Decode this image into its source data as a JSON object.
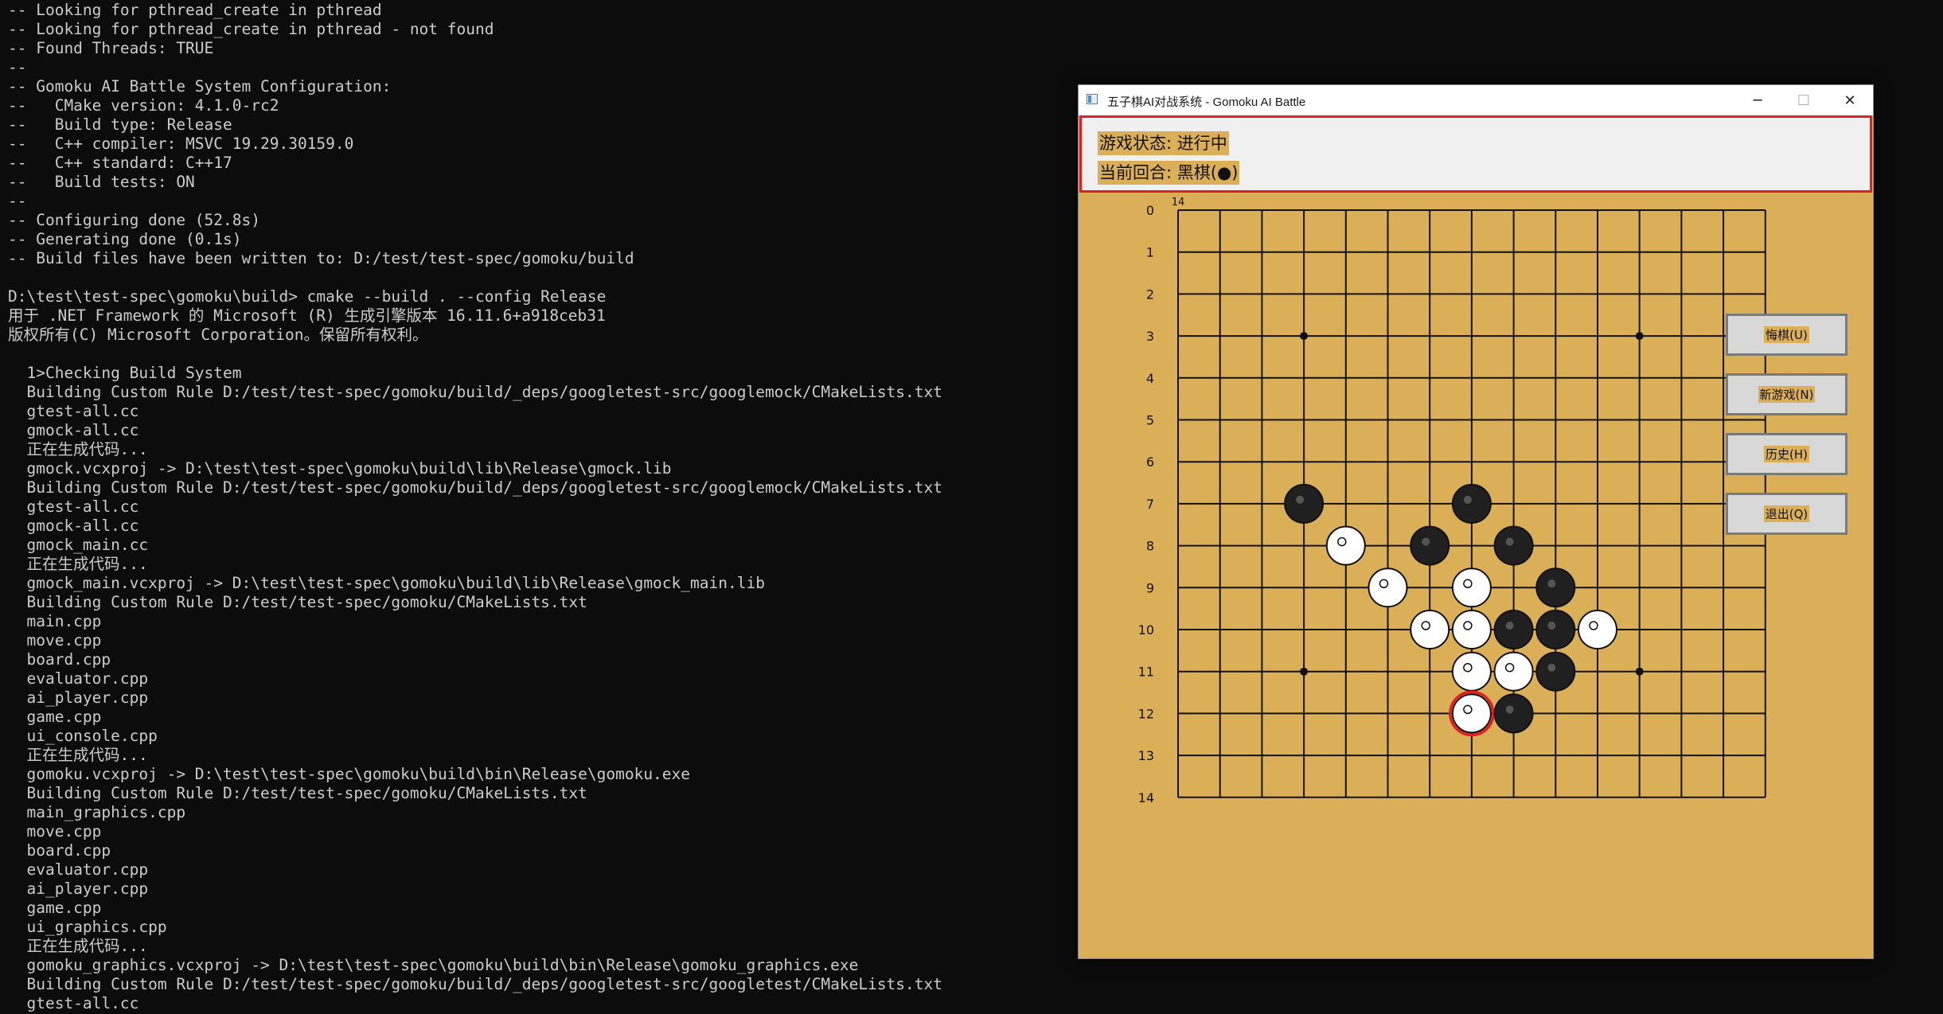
{
  "terminal": {
    "lines": [
      "-- Looking for pthread_create in pthread",
      "-- Looking for pthread_create in pthread - not found",
      "-- Found Threads: TRUE",
      "--",
      "-- Gomoku AI Battle System Configuration:",
      "--   CMake version: 4.1.0-rc2",
      "--   Build type: Release",
      "--   C++ compiler: MSVC 19.29.30159.0",
      "--   C++ standard: C++17",
      "--   Build tests: ON",
      "--",
      "-- Configuring done (52.8s)",
      "-- Generating done (0.1s)",
      "-- Build files have been written to: D:/test/test-spec/gomoku/build",
      "",
      "D:\\test\\test-spec\\gomoku\\build> cmake --build . --config Release",
      "用于 .NET Framework 的 Microsoft (R) 生成引擎版本 16.11.6+a918ceb31",
      "版权所有(C) Microsoft Corporation。保留所有权利。",
      "",
      "  1>Checking Build System",
      "  Building Custom Rule D:/test/test-spec/gomoku/build/_deps/googletest-src/googlemock/CMakeLists.txt",
      "  gtest-all.cc",
      "  gmock-all.cc",
      "  正在生成代码...",
      "  gmock.vcxproj -> D:\\test\\test-spec\\gomoku\\build\\lib\\Release\\gmock.lib",
      "  Building Custom Rule D:/test/test-spec/gomoku/build/_deps/googletest-src/googlemock/CMakeLists.txt",
      "  gtest-all.cc",
      "  gmock-all.cc",
      "  gmock_main.cc",
      "  正在生成代码...",
      "  gmock_main.vcxproj -> D:\\test\\test-spec\\gomoku\\build\\lib\\Release\\gmock_main.lib",
      "  Building Custom Rule D:/test/test-spec/gomoku/CMakeLists.txt",
      "  main.cpp",
      "  move.cpp",
      "  board.cpp",
      "  evaluator.cpp",
      "  ai_player.cpp",
      "  game.cpp",
      "  ui_console.cpp",
      "  正在生成代码...",
      "  gomoku.vcxproj -> D:\\test\\test-spec\\gomoku\\build\\bin\\Release\\gomoku.exe",
      "  Building Custom Rule D:/test/test-spec/gomoku/CMakeLists.txt",
      "  main_graphics.cpp",
      "  move.cpp",
      "  board.cpp",
      "  evaluator.cpp",
      "  ai_player.cpp",
      "  game.cpp",
      "  ui_graphics.cpp",
      "  正在生成代码...",
      "  gomoku_graphics.vcxproj -> D:\\test\\test-spec\\gomoku\\build\\bin\\Release\\gomoku_graphics.exe",
      "  Building Custom Rule D:/test/test-spec/gomoku/build/_deps/googletest-src/googletest/CMakeLists.txt",
      "  gtest-all.cc"
    ]
  },
  "window": {
    "title": "五子棋AI对战系统 - Gomoku AI Battle",
    "minimize_glyph": "─",
    "maximize_glyph": "☐",
    "close_glyph": "✕"
  },
  "status": {
    "game_state": "游戏状态: 进行中",
    "turn": "当前回合: 黑棋(●)"
  },
  "board": {
    "size": 15,
    "top_label": "14",
    "row_labels": [
      "0",
      "1",
      "2",
      "3",
      "4",
      "5",
      "6",
      "7",
      "8",
      "9",
      "10",
      "11",
      "12",
      "13",
      "14"
    ],
    "star_points": [
      [
        3,
        3
      ],
      [
        3,
        11
      ],
      [
        11,
        3
      ],
      [
        11,
        11
      ]
    ],
    "stones": [
      {
        "row": 7,
        "col": 3,
        "color": "black"
      },
      {
        "row": 7,
        "col": 7,
        "color": "black"
      },
      {
        "row": 8,
        "col": 4,
        "color": "white"
      },
      {
        "row": 8,
        "col": 6,
        "color": "black"
      },
      {
        "row": 8,
        "col": 8,
        "color": "black"
      },
      {
        "row": 9,
        "col": 5,
        "color": "white"
      },
      {
        "row": 9,
        "col": 7,
        "color": "white"
      },
      {
        "row": 9,
        "col": 9,
        "color": "black"
      },
      {
        "row": 10,
        "col": 6,
        "color": "white"
      },
      {
        "row": 10,
        "col": 7,
        "color": "white"
      },
      {
        "row": 10,
        "col": 8,
        "color": "black"
      },
      {
        "row": 10,
        "col": 9,
        "color": "black"
      },
      {
        "row": 10,
        "col": 10,
        "color": "white"
      },
      {
        "row": 11,
        "col": 7,
        "color": "white"
      },
      {
        "row": 11,
        "col": 8,
        "color": "white"
      },
      {
        "row": 11,
        "col": 9,
        "color": "black"
      },
      {
        "row": 12,
        "col": 7,
        "color": "white",
        "last": true
      },
      {
        "row": 12,
        "col": 8,
        "color": "black"
      }
    ]
  },
  "buttons": {
    "undo": "悔棋(U)",
    "new_game": "新游戏(N)",
    "history": "历史(H)",
    "exit": "退出(Q)"
  },
  "colors": {
    "board_bg": "#dbaf57",
    "status_border": "#e02020",
    "last_move_ring": "#e02020"
  }
}
